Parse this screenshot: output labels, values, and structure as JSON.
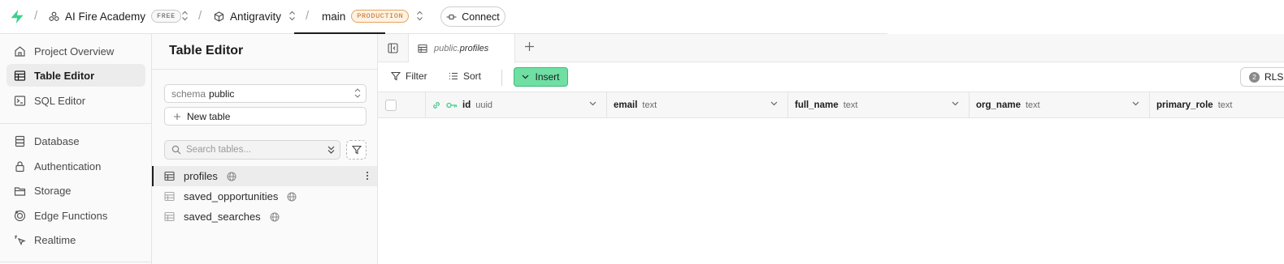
{
  "topbar": {
    "org": {
      "name": "AI Fire Academy",
      "plan": "FREE"
    },
    "project": {
      "name": "Antigravity"
    },
    "branch": {
      "name": "main",
      "env": "PRODUCTION"
    },
    "connect_label": "Connect",
    "separator": "/"
  },
  "nav": {
    "items": [
      {
        "label": "Project Overview",
        "icon": "home-icon"
      },
      {
        "label": "Table Editor",
        "icon": "table-icon",
        "active": true
      },
      {
        "label": "SQL Editor",
        "icon": "terminal-icon"
      },
      {
        "label": "Database",
        "icon": "database-icon"
      },
      {
        "label": "Authentication",
        "icon": "lock-icon"
      },
      {
        "label": "Storage",
        "icon": "archive-icon"
      },
      {
        "label": "Edge Functions",
        "icon": "functions-icon"
      },
      {
        "label": "Realtime",
        "icon": "cursor-click-icon"
      }
    ]
  },
  "table_panel": {
    "title": "Table Editor",
    "schema_label": "schema",
    "schema_value": "public",
    "new_table_label": "New table",
    "search_placeholder": "Search tables...",
    "tables": [
      {
        "name": "profiles",
        "active": true
      },
      {
        "name": "saved_opportunities"
      },
      {
        "name": "saved_searches"
      }
    ]
  },
  "main": {
    "tab": {
      "schema": "public.",
      "table": "profiles"
    },
    "toolbar": {
      "filter_label": "Filter",
      "sort_label": "Sort",
      "insert_label": "Insert",
      "rls_count": "2",
      "rls_label": "RLS"
    },
    "columns": [
      {
        "name": "id",
        "type": "uuid",
        "primary_key": true
      },
      {
        "name": "email",
        "type": "text"
      },
      {
        "name": "full_name",
        "type": "text"
      },
      {
        "name": "org_name",
        "type": "text"
      },
      {
        "name": "primary_role",
        "type": "text"
      }
    ]
  },
  "colors": {
    "accent": "#3ecf8e",
    "insert_bg": "#6fdfa4",
    "production": "#c56a16"
  }
}
